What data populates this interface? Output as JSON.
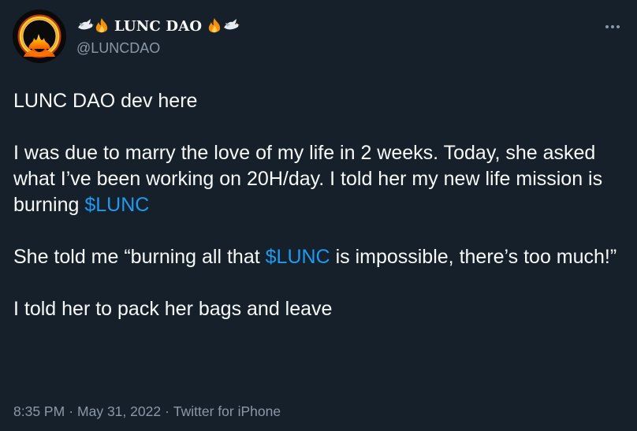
{
  "author": {
    "display_name": "LUNC DAO",
    "handle": "@LUNCDAO",
    "avatar": "flame-ring-logo",
    "name_icons": [
      "dove-icon",
      "fire-icon",
      "fire-icon",
      "dove-icon"
    ]
  },
  "menu_icon": "more-horizontal-icon",
  "tweet": {
    "line1": "LUNC DAO dev here",
    "para2_part1": "I was due to marry the love of my life in 2 weeks. Today, she asked what I’ve been working on 20H/day. I told her my new life mission is burning ",
    "cashtag1": "$LUNC",
    "para3_part1": "She told me “burning all that ",
    "cashtag2": "$LUNC",
    "para3_part2": " is impossible, there’s too much!”",
    "para4": "I told her to pack her bags and leave"
  },
  "meta": {
    "time": "8:35 PM",
    "date": "May 31, 2022",
    "source": "Twitter for iPhone",
    "separator": "·"
  },
  "colors": {
    "background": "#15202b",
    "text": "#f7f9f9",
    "secondary": "#8b98a5",
    "link": "#1d9bf0"
  }
}
